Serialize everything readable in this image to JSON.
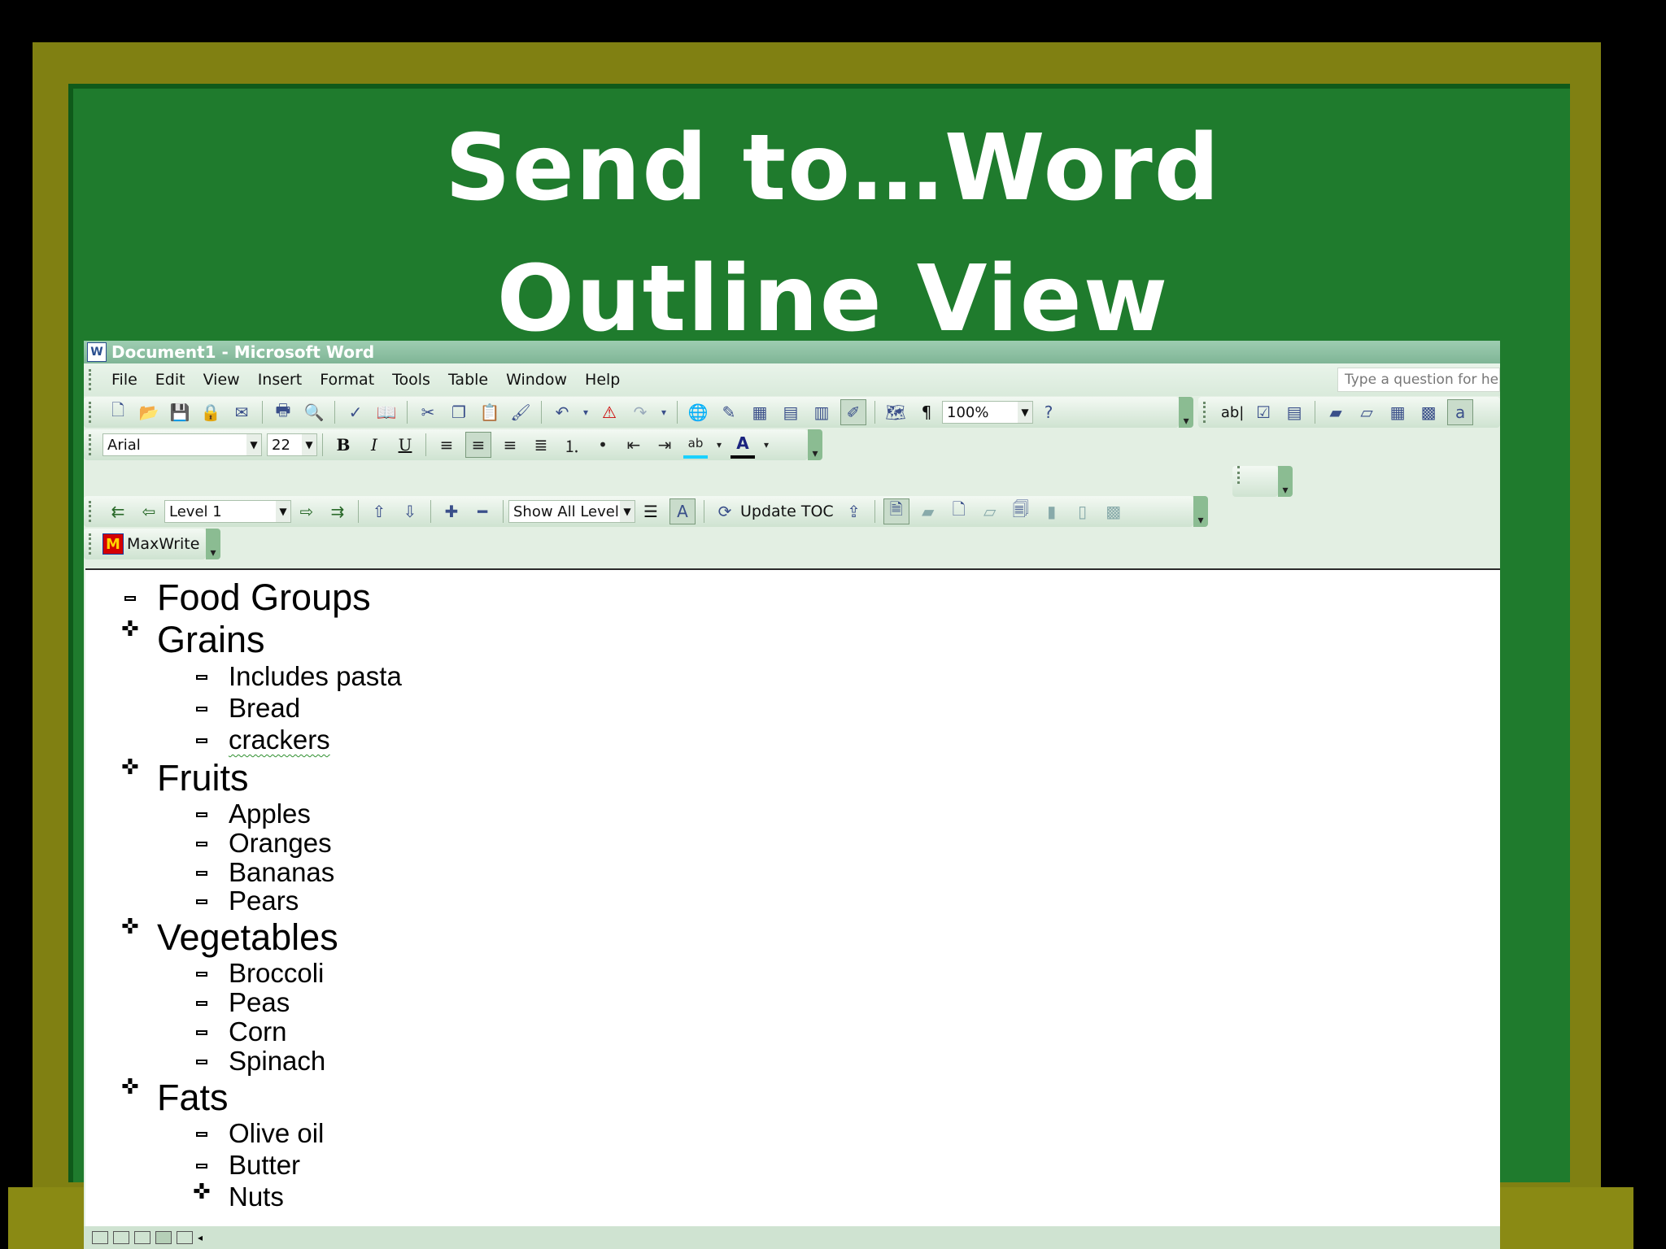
{
  "slide": {
    "title_line1": "Send to…Word",
    "title_line2": "Outline View"
  },
  "window": {
    "title": "Document1 - Microsoft Word",
    "app_icon": "W"
  },
  "menu": {
    "items": [
      "File",
      "Edit",
      "View",
      "Insert",
      "Format",
      "Tools",
      "Table",
      "Window",
      "Help"
    ],
    "ask_placeholder": "Type a question for he"
  },
  "standard_toolbar": {
    "zoom": "100%",
    "pilcrow": "¶",
    "form_text": "ab|"
  },
  "formatting_toolbar": {
    "font": "Arial",
    "size": "22",
    "bold": "B",
    "italic": "I",
    "underline": "U",
    "font_color_letter": "A",
    "highlight_letters": "ab"
  },
  "outlining_toolbar": {
    "level": "Level 1",
    "show_level": "Show All Level",
    "update_toc": "Update TOC"
  },
  "maxwrite_toolbar": {
    "label": "MaxWrite",
    "icon_letter": "M"
  },
  "outline": {
    "heading0": "Food Groups",
    "grains": "Grains",
    "grains_items": [
      "Includes pasta",
      "Bread",
      "crackers"
    ],
    "fruits": "Fruits",
    "fruits_items": [
      "Apples",
      "Oranges",
      "Bananas",
      "Pears"
    ],
    "vegetables": "Vegetables",
    "vegetables_items": [
      "Broccoli",
      "Peas",
      "Corn",
      "Spinach"
    ],
    "fats": "Fats",
    "fats_items": [
      "Olive oil",
      "Butter",
      "Nuts"
    ]
  },
  "colors": {
    "board": "#1f7b2d",
    "frame": "#808012",
    "toolbar_green": "#cfe3d1"
  }
}
